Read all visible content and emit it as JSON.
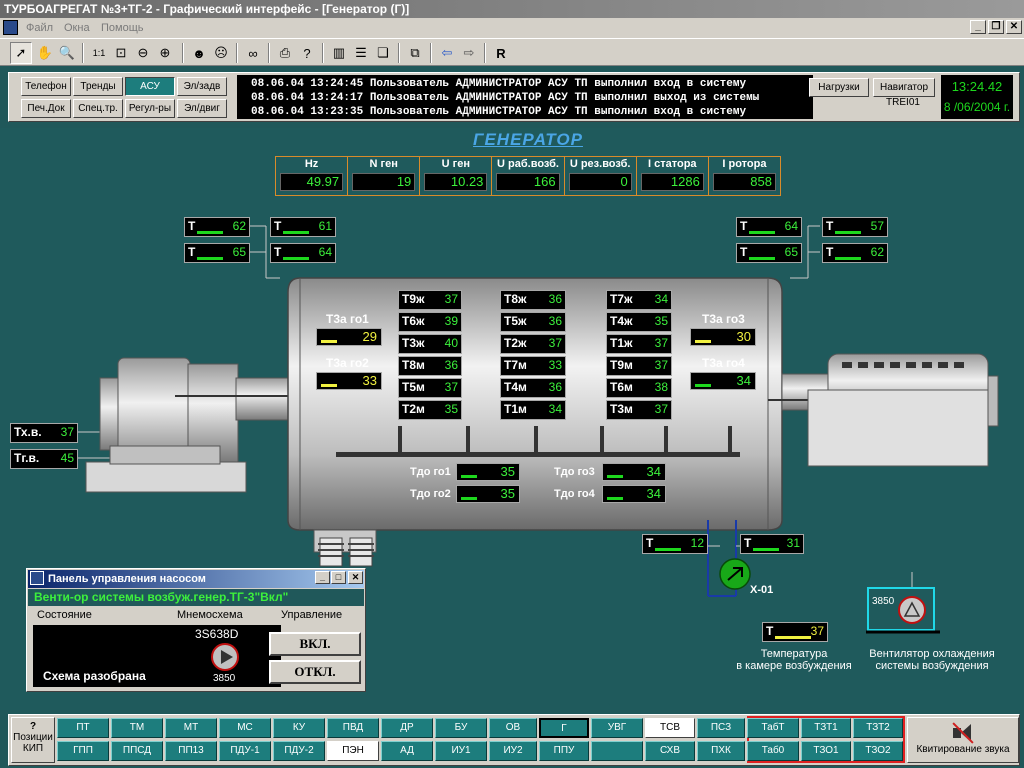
{
  "window": {
    "title": "ТУРБОАГРЕГАТ №3+ТГ-2 - Графический интерфейс - [Генератор (Г)]",
    "menu": [
      "Файл",
      "Окна",
      "Помощь"
    ]
  },
  "toolbar": {
    "buttons": [
      "pointer-icon",
      "hand-icon",
      "zoom-icon",
      "scale-1-1-icon",
      "zoom-fit-icon",
      "zoom-out-icon",
      "zoom-in-icon",
      "user-login-icon",
      "user-logout-icon",
      "binoculars-icon",
      "print-icon",
      "help-icon",
      "layout-columns-icon",
      "layout-rows-icon",
      "cascade-icon",
      "windows-icon",
      "back-arrow-icon",
      "forward-arrow-icon"
    ],
    "r_label": "R"
  },
  "nav": {
    "buttons": [
      {
        "label": "Телефон"
      },
      {
        "label": "Тренды"
      },
      {
        "label": "АСУ",
        "active": true
      },
      {
        "label": "Эл/задв"
      },
      {
        "label": "Печ.Док"
      },
      {
        "label": "Спец.тр."
      },
      {
        "label": "Регул-ры"
      },
      {
        "label": "Эл/двиг"
      }
    ],
    "log": [
      "08.06.04 13:24:45 Пользователь АДМИНИСТРАТОР АСУ ТП выполнил вход в систему",
      "08.06.04 13:24:17 Пользователь АДМИНИСТРАТОР АСУ ТП выполнил выход из системы",
      "08.06.04 13:23:35 Пользователь АДМИНИСТРАТОР АСУ ТП выполнил вход в систему"
    ],
    "nagruzki": "Нагрузки",
    "navigator": "Навигатор",
    "station": "TREI01",
    "time": "13:24.42",
    "date": "8 /06/2004 г."
  },
  "screen": {
    "title": "ГЕНЕРАТОР",
    "params": [
      {
        "label": "Hz",
        "value": "49.97"
      },
      {
        "label": "N ген",
        "value": "19"
      },
      {
        "label": "U ген",
        "value": "10.23"
      },
      {
        "label": "U раб.возб.",
        "value": "166"
      },
      {
        "label": "U рез.возб.",
        "value": "0"
      },
      {
        "label": "I статора",
        "value": "1286"
      },
      {
        "label": "I ротора",
        "value": "858"
      }
    ],
    "temps_left": [
      {
        "l": "Т",
        "v": "62"
      },
      {
        "l": "Т",
        "v": "61"
      },
      {
        "l": "Т",
        "v": "65"
      },
      {
        "l": "Т",
        "v": "64"
      }
    ],
    "temps_right": [
      {
        "l": "Т",
        "v": "64"
      },
      {
        "l": "Т",
        "v": "57"
      },
      {
        "l": "Т",
        "v": "65"
      },
      {
        "l": "Т",
        "v": "62"
      }
    ],
    "coolers": [
      {
        "l": "Т3а го1",
        "v": "29",
        "yellow": true
      },
      {
        "l": "Т3а го2",
        "v": "33",
        "yellow": true
      },
      {
        "l": "Т3а го3",
        "v": "30",
        "yellow": true
      },
      {
        "l": "Т3а го4",
        "v": "34",
        "yellow": false
      }
    ],
    "stator_col1": [
      {
        "l": "Т9ж",
        "v": "37"
      },
      {
        "l": "Т6ж",
        "v": "39"
      },
      {
        "l": "Т3ж",
        "v": "40"
      },
      {
        "l": "Т8м",
        "v": "36"
      },
      {
        "l": "Т5м",
        "v": "37"
      },
      {
        "l": "Т2м",
        "v": "35"
      }
    ],
    "stator_col2": [
      {
        "l": "Т8ж",
        "v": "36"
      },
      {
        "l": "Т5ж",
        "v": "36"
      },
      {
        "l": "Т2ж",
        "v": "37"
      },
      {
        "l": "Т7м",
        "v": "33"
      },
      {
        "l": "Т4м",
        "v": "36"
      },
      {
        "l": "Т1м",
        "v": "34"
      }
    ],
    "stator_col3": [
      {
        "l": "Т7ж",
        "v": "34"
      },
      {
        "l": "Т4ж",
        "v": "35"
      },
      {
        "l": "Т1ж",
        "v": "37"
      },
      {
        "l": "Т9м",
        "v": "37"
      },
      {
        "l": "Т6м",
        "v": "38"
      },
      {
        "l": "Т3м",
        "v": "37"
      }
    ],
    "tdo": [
      {
        "l": "Тдо го1",
        "v": "35"
      },
      {
        "l": "Тдо го2",
        "v": "35"
      },
      {
        "l": "Тдо го3",
        "v": "34"
      },
      {
        "l": "Тдо го4",
        "v": "34"
      }
    ],
    "txv": {
      "l": "Тх.в.",
      "v": "37"
    },
    "tgv": {
      "l": "Тг.в.",
      "v": "45"
    },
    "cooler_pipe": [
      {
        "l": "Т",
        "v": "12"
      },
      {
        "l": "Т",
        "v": "31"
      }
    ],
    "x01": "Х-01",
    "fan_code": "3850",
    "chamber_temp": {
      "l": "Т",
      "v": "37"
    },
    "chamber_caption": [
      "Температура",
      "в камере возбуждения"
    ],
    "fan_caption": [
      "Вентилятор охлаждения",
      "системы возбуждения"
    ]
  },
  "pump_panel": {
    "title": "Панель управления насосом",
    "name": "Венти-ор системы возбуж.генер.ТГ-3\"Вкл\"",
    "hdr_state": "Состояние",
    "hdr_mnemo": "Мнемосхема",
    "hdr_control": "Управление",
    "code": "3S638D",
    "status": "Схема разобрана",
    "num": "3850",
    "on": "ВКЛ.",
    "off": "ОТКЛ."
  },
  "bottom": {
    "poz": [
      "?",
      "Позиции",
      "КИП"
    ],
    "row1": [
      "ПТ",
      "ТМ",
      "МТ",
      "МС",
      "КУ",
      "ПВД",
      "ДР",
      "БУ",
      "ОВ",
      "Г",
      "УВГ",
      "ТСВ",
      "ПСЗ",
      "ТабТ",
      "ТЗТ1",
      "ТЗТ2"
    ],
    "row2": [
      "ГПП",
      "ППСД",
      "ПП13",
      "ПДУ-1",
      "ПДУ-2",
      "ПЭН",
      "АД",
      "ИУ1",
      "ИУ2",
      "ППУ",
      "",
      "СХВ",
      "ПХК",
      "Таб0",
      "ТЗО1",
      "ТЗО2"
    ],
    "kvit": "Квитирование звука"
  }
}
